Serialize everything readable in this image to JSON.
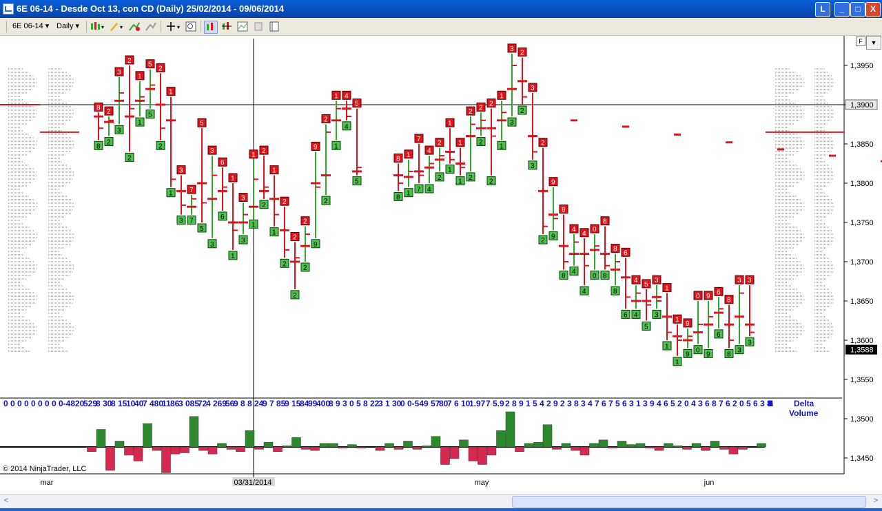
{
  "window": {
    "title": "6E 06-14 - Desde Oct 13, con CD (Daily)  25/02/2014 - 09/06/2014",
    "buttons": {
      "restore_small": "L",
      "minimize": "_",
      "maximize": "□",
      "close": "X"
    }
  },
  "toolbar": {
    "instrument": "6E 06-14",
    "interval": "Daily",
    "icons": [
      "bar-style-icon",
      "pencil-draw-icon",
      "add-indicator-icon",
      "strategy-icon",
      "crosshair-icon",
      "zoom-icon",
      "chart-properties-icon",
      "data-series-icon",
      "indicators-icon",
      "templates-icon",
      "window-layout-icon"
    ]
  },
  "chart_header": {
    "f_label": "F"
  },
  "colors": {
    "up": "#2ea82e",
    "down": "#d9141c",
    "box_up": "#4fc04f",
    "box_down": "#e2141b",
    "axis": "#000000",
    "delta_label": "#1515c0"
  },
  "axis": {
    "price_ticks": [
      "1,3950",
      "1,3900",
      "1,3850",
      "1,3800",
      "1,3750",
      "1,3700",
      "1,3650",
      "1,3600",
      "1,3550",
      "1,3500",
      "1,3450"
    ],
    "crosshair_price": "1,3900",
    "last_price": "1,3588",
    "x_labels": [
      "mar",
      "03/31/2014",
      "may",
      "jun"
    ]
  },
  "delta_volume": {
    "label_line1": "Delta",
    "label_line2": "Volume",
    "values": [
      "0",
      "0",
      "0",
      "0",
      "0",
      "0",
      "0",
      "0",
      "0-48",
      "20",
      "529",
      "8",
      "30",
      "8",
      "15",
      "10",
      "40",
      "7",
      "480",
      "11",
      "86",
      "3",
      "085",
      "72",
      "4",
      "269",
      "56",
      "9",
      "8",
      "8",
      "24",
      "9",
      "7",
      "85",
      "9",
      "15",
      "84",
      "99",
      "400",
      "8",
      "9",
      "3",
      "0",
      "5",
      "8",
      "22",
      "3",
      "1",
      "30",
      "0",
      "0-54",
      "9",
      "57",
      "80",
      "7",
      "6",
      "10",
      "1.97",
      "7",
      "5.9",
      "2",
      "8",
      "9",
      "1",
      "5",
      "4",
      "2",
      "9",
      "2",
      "3",
      "8",
      "3",
      "4",
      "7",
      "6",
      "7",
      "5",
      "6",
      "3",
      "1",
      "3",
      "9",
      "4",
      "6",
      "5",
      "2",
      "0",
      "4",
      "3",
      "6",
      "8",
      "7",
      "6",
      "2",
      "0",
      "5",
      "6",
      "3",
      "8",
      "4",
      "7",
      "2",
      "0",
      "6",
      "1",
      "2",
      "1",
      "5",
      "1",
      "2",
      "0",
      "1",
      "3",
      "4",
      "8",
      "0",
      "6",
      "3",
      "0"
    ]
  },
  "footer": {
    "copyright": "© 2014 NinjaTrader, LLC"
  },
  "hscroll": {
    "left": "<",
    "right": ">"
  },
  "chart_data": {
    "type": "bar",
    "ylim": [
      1.342,
      1.3975
    ],
    "session_levels": [
      1.39,
      1.3865
    ],
    "moving_average": [
      [
        55,
        1.388
      ],
      [
        60,
        1.3872
      ],
      [
        65,
        1.3862
      ],
      [
        70,
        1.3852
      ],
      [
        75,
        1.3843
      ],
      [
        80,
        1.3835
      ],
      [
        85,
        1.3828
      ],
      [
        90,
        1.3822
      ],
      [
        95,
        1.3815
      ],
      [
        100,
        1.3812
      ],
      [
        105,
        1.3812
      ],
      [
        110,
        1.3814
      ],
      [
        115,
        1.3817
      ],
      [
        120,
        1.3819
      ],
      [
        125,
        1.3818
      ],
      [
        130,
        1.3817
      ],
      [
        135,
        1.3816
      ],
      [
        140,
        1.3818
      ],
      [
        145,
        1.3822
      ],
      [
        150,
        1.3822
      ],
      [
        155,
        1.382
      ],
      [
        160,
        1.3818
      ],
      [
        165,
        1.3815
      ],
      [
        170,
        1.3812
      ],
      [
        175,
        1.3808
      ],
      [
        180,
        1.3803
      ],
      [
        185,
        1.3798
      ],
      [
        190,
        1.3793
      ],
      [
        195,
        1.379
      ],
      [
        200,
        1.3788
      ],
      [
        205,
        1.3786
      ],
      [
        210,
        1.3784
      ]
    ],
    "candles": [
      [
        9,
        1.388,
        1.389,
        1.3855,
        1.387,
        1.3885,
        "8",
        "8",
        "8",
        "8"
      ],
      [
        10,
        1.387,
        1.3885,
        1.386,
        1.388,
        1.3878,
        "2",
        "2",
        "8",
        "8"
      ],
      [
        11,
        1.388,
        1.3935,
        1.3875,
        1.3915,
        1.3905,
        "3",
        "3",
        "7",
        "7"
      ],
      [
        12,
        1.3915,
        1.395,
        1.384,
        1.3895,
        1.3885,
        "2",
        "2",
        "3",
        "3"
      ],
      [
        13,
        1.3895,
        1.393,
        1.3885,
        1.391,
        1.3905,
        "1",
        "1",
        "0",
        "0"
      ],
      [
        14,
        1.391,
        1.3945,
        1.3895,
        1.3925,
        1.392,
        "5",
        "5",
        "1",
        "1"
      ],
      [
        15,
        1.3925,
        1.394,
        1.3855,
        1.387,
        1.39,
        "2",
        "2",
        "8",
        "8"
      ],
      [
        16,
        1.387,
        1.391,
        1.3795,
        1.3805,
        1.388,
        "1",
        "1",
        "4",
        "4"
      ],
      [
        17,
        1.3805,
        1.381,
        1.376,
        1.3772,
        1.379,
        "3",
        "3",
        "1",
        "1"
      ],
      [
        18,
        1.3772,
        1.3785,
        1.376,
        1.378,
        1.377,
        "7",
        "7",
        "3",
        "3"
      ],
      [
        19,
        1.378,
        1.387,
        1.375,
        1.3775,
        1.38,
        "5",
        "5",
        "3",
        "3"
      ],
      [
        20,
        1.3775,
        1.3835,
        1.373,
        1.381,
        1.378,
        "3",
        "3",
        "5",
        "5"
      ],
      [
        21,
        1.381,
        1.382,
        1.3765,
        1.3795,
        1.379,
        "6",
        "6",
        "6",
        "6"
      ],
      [
        22,
        1.3795,
        1.38,
        1.3715,
        1.374,
        1.375,
        "1",
        "1",
        "2",
        "2"
      ],
      [
        23,
        1.374,
        1.3775,
        1.3735,
        1.376,
        1.375,
        "3",
        "3",
        "8",
        "8"
      ],
      [
        24,
        1.376,
        1.383,
        1.3755,
        1.3805,
        1.377,
        "1",
        "1",
        "3",
        "3"
      ],
      [
        25,
        1.3805,
        1.3835,
        1.378,
        1.3795,
        1.379,
        "2",
        "2",
        "3",
        "3"
      ],
      [
        26,
        1.3795,
        1.381,
        1.3745,
        1.376,
        1.378,
        "1",
        "1",
        "3",
        "3"
      ],
      [
        27,
        1.376,
        1.377,
        1.3705,
        1.3715,
        1.374,
        "2",
        "2",
        "3",
        "3"
      ],
      [
        28,
        1.3715,
        1.3725,
        1.3665,
        1.3705,
        1.37,
        "2",
        "2",
        "8",
        "8"
      ],
      [
        29,
        1.3705,
        1.3745,
        1.37,
        1.3735,
        1.372,
        "2",
        "2",
        "3",
        "3"
      ],
      [
        30,
        1.3735,
        1.384,
        1.373,
        1.3795,
        1.38,
        "9",
        "9",
        "7",
        "7"
      ],
      [
        31,
        1.3795,
        1.3875,
        1.3785,
        1.3865,
        1.381,
        "2",
        "2",
        "2",
        "2"
      ],
      [
        32,
        1.3865,
        1.3905,
        1.3855,
        1.3895,
        1.388,
        "1",
        "1",
        "9",
        "9"
      ],
      [
        33,
        1.3895,
        1.3905,
        1.388,
        1.3885,
        1.3895,
        "4",
        "4",
        "0",
        "0"
      ],
      [
        34,
        1.3885,
        1.3895,
        1.381,
        1.382,
        1.3815,
        "5",
        "5",
        "8",
        "8"
      ],
      [
        38,
        1.382,
        1.3825,
        1.379,
        1.38,
        1.381,
        "8",
        "8",
        "5",
        "5"
      ],
      [
        39,
        1.38,
        1.383,
        1.3795,
        1.3815,
        1.3808,
        "1",
        "1",
        "6",
        "6"
      ],
      [
        40,
        1.3815,
        1.385,
        1.38,
        1.381,
        1.3815,
        "7",
        "7",
        "3",
        "3"
      ],
      [
        41,
        1.381,
        1.3835,
        1.38,
        1.3825,
        1.382,
        "4",
        "4",
        "8",
        "8"
      ],
      [
        42,
        1.3825,
        1.3845,
        1.3815,
        1.3835,
        1.383,
        "2",
        "2",
        "8",
        "8"
      ],
      [
        43,
        1.3835,
        1.387,
        1.3825,
        1.383,
        1.384,
        "1",
        "1",
        "4",
        "4"
      ],
      [
        44,
        1.383,
        1.3845,
        1.381,
        1.382,
        1.3825,
        "1",
        "1",
        "6",
        "6"
      ],
      [
        45,
        1.382,
        1.3885,
        1.3815,
        1.3875,
        1.386,
        "2",
        "2",
        "6",
        "6"
      ],
      [
        46,
        1.3875,
        1.389,
        1.386,
        1.388,
        1.387,
        "2",
        "2",
        "1",
        "1"
      ],
      [
        47,
        1.388,
        1.3895,
        1.381,
        1.386,
        1.387,
        "2",
        "2",
        "3",
        "3"
      ],
      [
        48,
        1.386,
        1.3905,
        1.3855,
        1.389,
        1.388,
        "1",
        "1",
        "2",
        "2"
      ],
      [
        49,
        1.389,
        1.3965,
        1.3885,
        1.395,
        1.392,
        "3",
        "3",
        "1",
        "1"
      ],
      [
        50,
        1.395,
        1.396,
        1.39,
        1.391,
        1.393,
        "2",
        "2",
        "3",
        "3"
      ],
      [
        51,
        1.391,
        1.3915,
        1.383,
        1.384,
        1.386,
        "3",
        "3",
        "1",
        "1"
      ],
      [
        52,
        1.384,
        1.3845,
        1.3735,
        1.3745,
        1.379,
        "2",
        "2",
        "3",
        "3"
      ],
      [
        53,
        1.3745,
        1.3795,
        1.374,
        1.3755,
        1.376,
        "9",
        "9",
        "1",
        "1"
      ],
      [
        54,
        1.3755,
        1.376,
        1.369,
        1.37,
        1.372,
        "8",
        "8",
        "3",
        "3"
      ],
      [
        55,
        1.37,
        1.3735,
        1.3695,
        1.3725,
        1.371,
        "4",
        "4",
        "6",
        "6"
      ],
      [
        56,
        1.3725,
        1.373,
        1.367,
        1.3695,
        1.371,
        "4",
        "4",
        "1",
        "1"
      ],
      [
        57,
        1.3695,
        1.3735,
        1.369,
        1.372,
        1.3715,
        "0",
        "0",
        "3",
        "3"
      ],
      [
        58,
        1.372,
        1.3745,
        1.369,
        1.3695,
        1.371,
        "8",
        "8",
        "1",
        "1"
      ],
      [
        59,
        1.3695,
        1.371,
        1.367,
        1.37,
        1.369,
        "8",
        "8",
        "0",
        "0"
      ],
      [
        60,
        1.37,
        1.3705,
        1.364,
        1.3655,
        1.368,
        "6",
        "6",
        "3",
        "3"
      ],
      [
        61,
        1.3655,
        1.367,
        1.364,
        1.366,
        1.365,
        "4",
        "4",
        "7",
        "7"
      ],
      [
        62,
        1.366,
        1.3665,
        1.3625,
        1.3645,
        1.365,
        "5",
        "5",
        "2",
        "2"
      ],
      [
        63,
        1.3645,
        1.367,
        1.364,
        1.365,
        1.3655,
        "3",
        "3",
        "2",
        "2"
      ],
      [
        64,
        1.365,
        1.366,
        1.36,
        1.361,
        1.363,
        "1",
        "1",
        "0",
        "0"
      ],
      [
        65,
        1.361,
        1.362,
        1.358,
        1.36,
        1.3605,
        "1",
        "1",
        "4",
        "4"
      ],
      [
        66,
        1.36,
        1.3615,
        1.359,
        1.3605,
        1.36,
        "9",
        "9",
        "2",
        "2"
      ],
      [
        67,
        1.3605,
        1.365,
        1.3595,
        1.362,
        1.361,
        "0",
        "0",
        "1",
        "1"
      ],
      [
        68,
        1.362,
        1.365,
        1.359,
        1.363,
        1.362,
        "9",
        "9",
        "8",
        "8"
      ],
      [
        69,
        1.363,
        1.3655,
        1.3615,
        1.364,
        1.3635,
        "6",
        "6",
        "6",
        "6"
      ],
      [
        70,
        1.364,
        1.3645,
        1.359,
        1.36,
        1.362,
        "8",
        "8",
        "1",
        "1"
      ],
      [
        71,
        1.36,
        1.367,
        1.3595,
        1.366,
        1.363,
        "3",
        "3",
        "7",
        "7"
      ],
      [
        72,
        1.366,
        1.367,
        1.3605,
        1.361,
        1.362,
        "3",
        "3",
        "7",
        "7"
      ]
    ],
    "delta": [
      0,
      0,
      0,
      0,
      0,
      0,
      0,
      0,
      0,
      -4,
      15,
      -20,
      5,
      -7,
      -12,
      20,
      -3,
      -22,
      -6,
      -5,
      26,
      -3,
      -6,
      3,
      -2,
      -4,
      14,
      -2,
      4,
      -4,
      1,
      8,
      -2,
      -3,
      3,
      3,
      -1,
      2,
      -1,
      0,
      -3,
      3,
      -2,
      5,
      -2,
      1,
      9,
      -15,
      -10,
      6,
      -12,
      -15,
      -7,
      14,
      30,
      -4,
      3,
      4,
      19,
      -2,
      3,
      -3,
      -7,
      3,
      6,
      -1,
      5,
      2,
      3,
      -1,
      -3,
      3,
      1,
      -2,
      3,
      -3,
      5,
      -2,
      -6,
      -2,
      0,
      3
    ],
    "price_labels": {
      "y": [
        1.395,
        1.39,
        1.385,
        1.38,
        1.375,
        1.37,
        1.365,
        1.36,
        1.355,
        1.35,
        1.345
      ]
    }
  }
}
